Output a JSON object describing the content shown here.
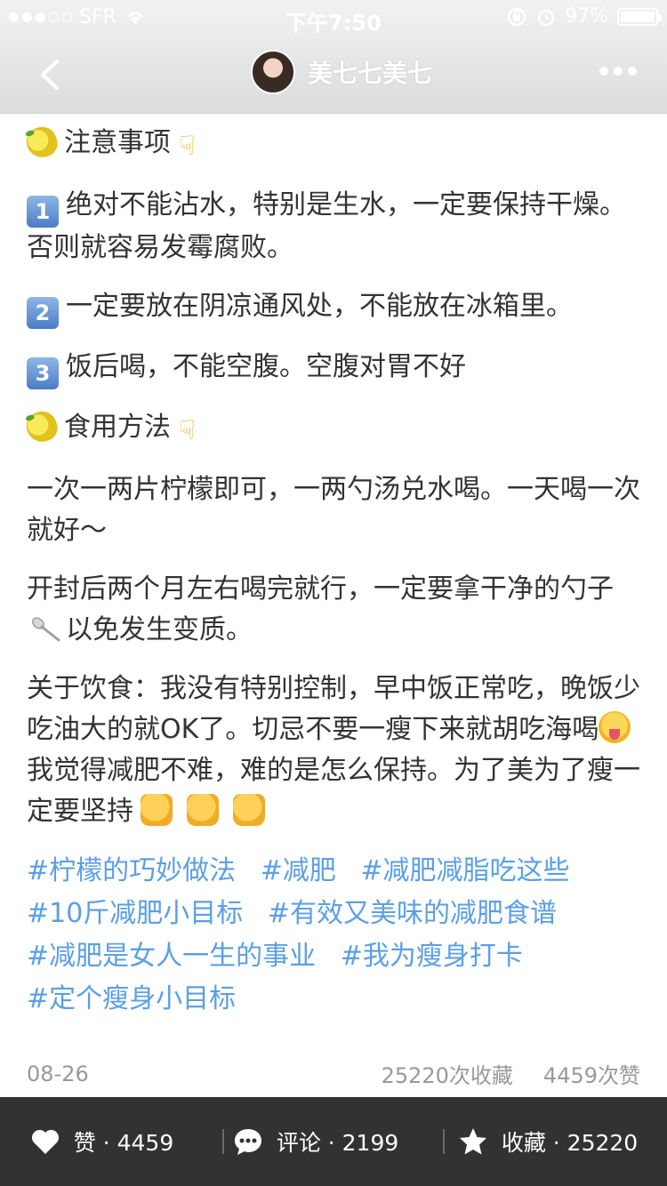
{
  "status_bar": {
    "carrier": "SFR",
    "time": "下午7:50",
    "battery": "97%"
  },
  "nav": {
    "author_name": "美七七美七"
  },
  "content": {
    "section1_title": "注意事项",
    "item1": "绝对不能沾水，特别是生水，一定要保持干燥。否则就容易发霉腐败。",
    "item2": "一定要放在阴凉通风处，不能放在冰箱里。",
    "item3": "饭后喝，不能空腹。空腹对胃不好",
    "section2_title": "食用方法",
    "para1": "一次一两片柠檬即可，一两勺汤兑水喝。一天喝一次就好～",
    "para2_a": "开封后两个月左右喝完就行，一定要拿干净的勺子",
    "para2_b": "以免发生变质。",
    "para3_a": "关于饮食：我没有特别控制，早中饭正常吃，晚饭少吃油大的就OK了。切忌不要一瘦下来就胡吃海喝",
    "para3_b": "我觉得减肥不难，难的是怎么保持。为了美为了瘦一定要坚持",
    "numbers": [
      "1",
      "2",
      "3"
    ]
  },
  "tags": [
    "#柠檬的巧妙做法",
    "#减肥",
    "#减肥减脂吃这些",
    "#10斤减肥小目标",
    "#有效又美味的减肥食谱",
    "#减肥是女人一生的事业",
    "#我为瘦身打卡",
    "#定个瘦身小目标"
  ],
  "meta": {
    "date": "08-26",
    "favorites": "25220次收藏",
    "likes": "4459次赞"
  },
  "bottom_bar": {
    "like_label": "赞 · 4459",
    "comment_label": "评论 · 2199",
    "favorite_label": "收藏 · 25220"
  },
  "colors": {
    "tag_blue": "#5b9fe6",
    "bottom_bar_bg": "#323232",
    "text": "#333333",
    "meta_gray": "#999999"
  }
}
